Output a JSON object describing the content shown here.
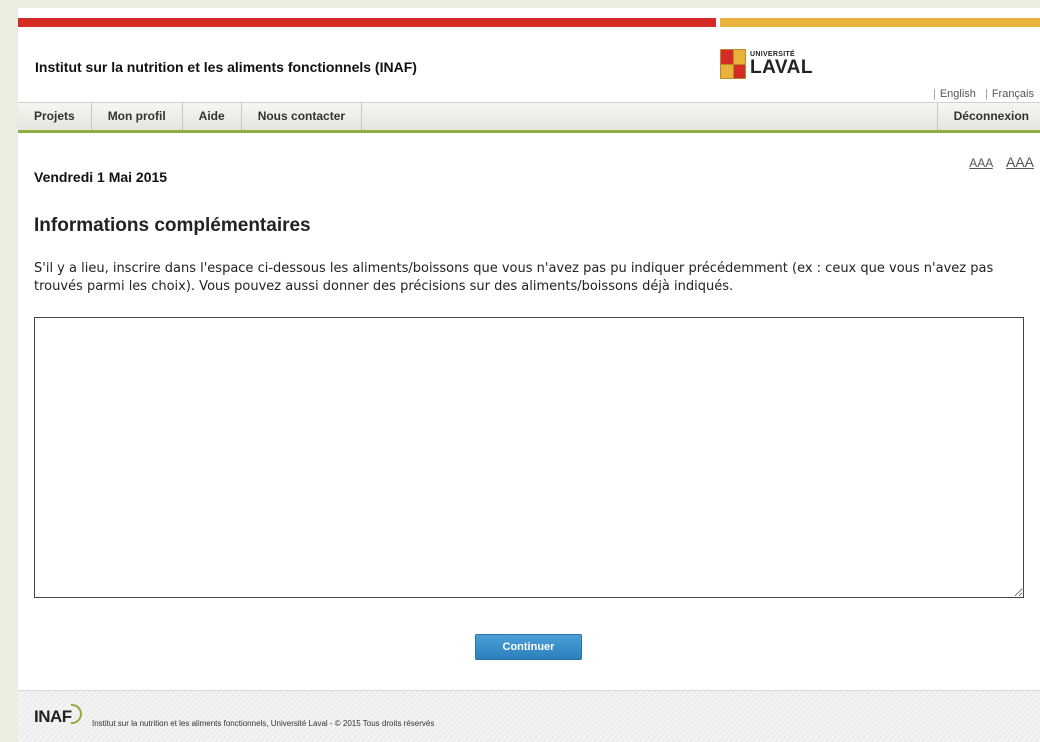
{
  "header": {
    "site_title": "Institut sur la nutrition et les aliments fonctionnels (INAF)",
    "logo_small": "UNIVERSITÉ",
    "logo_big": "LAVAL",
    "lang_english": "English",
    "lang_francais": "Français"
  },
  "nav": {
    "items": [
      "Projets",
      "Mon profil",
      "Aide",
      "Nous contacter"
    ],
    "logout": "Déconnexion"
  },
  "content": {
    "date": "Vendredi 1 Mai 2015",
    "font_small": "AAA",
    "font_large": "AAA",
    "heading": "Informations complémentaires",
    "paragraph": "S'il y a lieu, inscrire dans l'espace ci-dessous les aliments/boissons que vous n'avez pas pu indiquer précédemment (ex : ceux que vous n'avez pas trouvés parmi les choix). Vous pouvez aussi donner des précisions sur des aliments/boissons déjà indiqués.",
    "textarea_value": "",
    "continue_label": "Continuer"
  },
  "footer": {
    "logo_text": "INAF",
    "text": "Institut sur la nutrition et les aliments fonctionnels, Université Laval - © 2015 Tous droits réservés"
  },
  "colors": {
    "red": "#d52b27",
    "gold": "#e9b23d",
    "green": "#8fae3c",
    "button_blue": "#2b7fbe"
  }
}
